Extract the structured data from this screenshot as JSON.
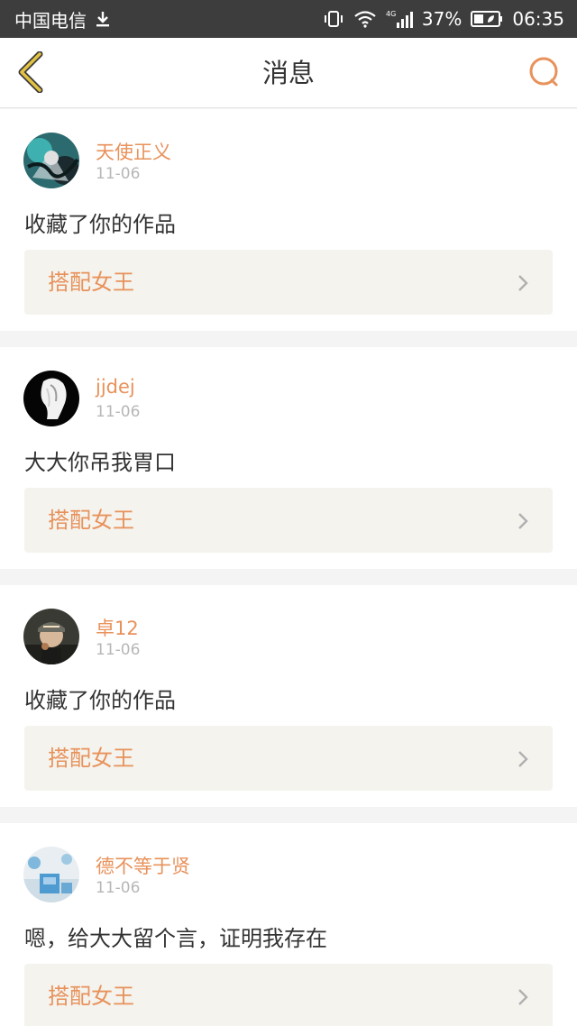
{
  "status_bar": {
    "carrier": "中国电信",
    "network": "4G",
    "battery": "37%",
    "time": "06:35"
  },
  "nav": {
    "title": "消息",
    "accent_color": "#e8925b"
  },
  "messages": [
    {
      "username": "天使正义",
      "date": "11-06",
      "text": "收藏了你的作品",
      "link_label": "搭配女王"
    },
    {
      "username": "jjdej",
      "date": "11-06",
      "text": "大大你吊我胃口",
      "link_label": "搭配女王"
    },
    {
      "username": "卓12",
      "date": "11-06",
      "text": "收藏了你的作品",
      "link_label": "搭配女王"
    },
    {
      "username": "德不等于贤",
      "date": "11-06",
      "text": "嗯，给大大留个言，证明我存在",
      "link_label": "搭配女王"
    }
  ]
}
